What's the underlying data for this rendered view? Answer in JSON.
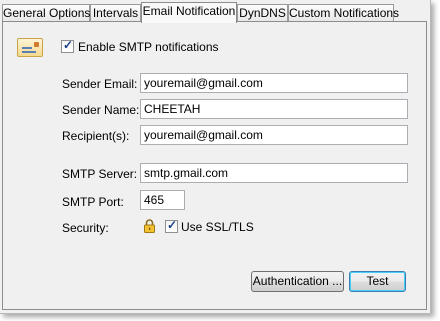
{
  "tabs": [
    {
      "label": "General Options",
      "active": false
    },
    {
      "label": "Intervals",
      "active": false
    },
    {
      "label": "Email Notification",
      "active": true
    },
    {
      "label": "DynDNS",
      "active": false
    },
    {
      "label": "Custom Notifications",
      "active": false
    }
  ],
  "smtp": {
    "enable_label": "Enable SMTP notifications",
    "enabled": true,
    "icon": "envelope-icon"
  },
  "form": {
    "sender_email_label": "Sender Email:",
    "sender_email_value": "youremail@gmail.com",
    "sender_name_label": "Sender Name:",
    "sender_name_value": "CHEETAH",
    "recipients_label": "Recipient(s):",
    "recipients_value": "youremail@gmail.com",
    "smtp_server_label": "SMTP Server:",
    "smtp_server_value": "smtp.gmail.com",
    "smtp_port_label": "SMTP Port:",
    "smtp_port_value": "465",
    "security_label": "Security:",
    "security_icon": "lock-icon",
    "ssl_label": "Use SSL/TLS",
    "ssl_checked": true
  },
  "buttons": {
    "authentication_label": "Authentication ...",
    "test_label": "Test"
  },
  "colors": {
    "panel_bg": "#f0f0f0",
    "border": "#8c8c8c",
    "checkmark": "#1c3f8a"
  }
}
